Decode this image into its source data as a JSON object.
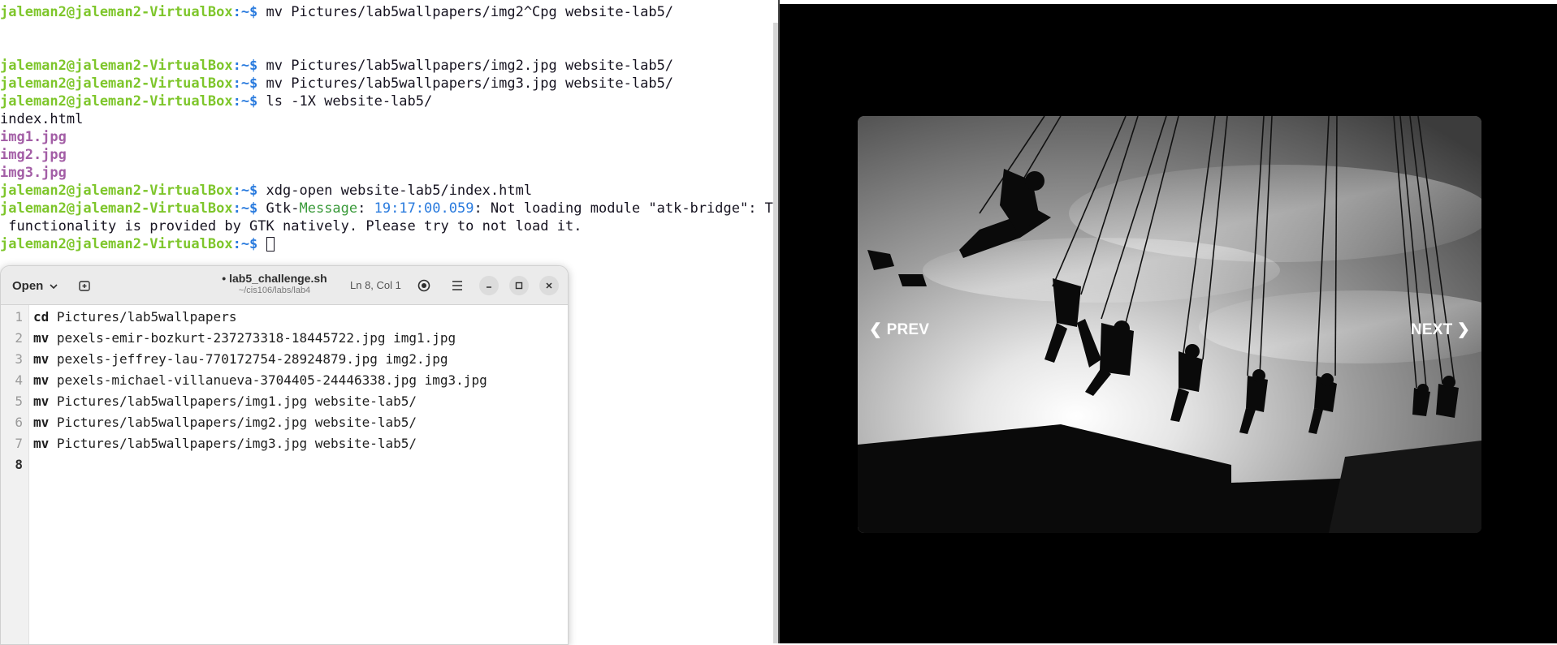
{
  "terminal": {
    "user_host": "jaleman2@jaleman2-VirtualBox",
    "path": ":~$",
    "commands": {
      "c1": " mv Pictures/lab5wallpapers/img2^Cpg website-lab5/",
      "c2": " mv Pictures/lab5wallpapers/img2.jpg website-lab5/",
      "c3": " mv Pictures/lab5wallpapers/img3.jpg website-lab5/",
      "c4": " ls -1X website-lab5/",
      "c5": " xdg-open website-lab5/index.html",
      "c6_pre": " Gtk-",
      "c6_word": "Message",
      "c6_colon": ": ",
      "c6_time": "19:17:00.059",
      "c6_rest": ": Not loading module \"atk-bridge\": The",
      "c6_wrap": " functionality is provided by GTK natively. Please try to not load it.",
      "c7": " "
    },
    "ls_output": [
      "index.html",
      "img1.jpg",
      "img2.jpg",
      "img3.jpg"
    ]
  },
  "browser": {
    "prev_label": "❮ PREV",
    "next_label": "NEXT ❯",
    "colors": {
      "background": "#000000",
      "nav_text": "#ffffff"
    }
  },
  "editor": {
    "open_label": "Open",
    "file_title": "• lab5_challenge.sh",
    "file_path": "~/cis106/labs/lab4",
    "cursor_pos": "Ln 8, Col  1",
    "line_numbers": [
      "1",
      "2",
      "3",
      "4",
      "5",
      "6",
      "7",
      "8"
    ],
    "lines": [
      {
        "cmd": "cd",
        "args": " Pictures/lab5wallpapers"
      },
      {
        "cmd": "mv",
        "args": " pexels-emir-bozkurt-237273318-18445722.jpg img1.jpg"
      },
      {
        "cmd": "mv",
        "args": " pexels-jeffrey-lau-770172754-28924879.jpg img2.jpg"
      },
      {
        "cmd": "mv",
        "args": " pexels-michael-villanueva-3704405-24446338.jpg img3.jpg"
      },
      {
        "cmd": "mv",
        "args": " Pictures/lab5wallpapers/img1.jpg website-lab5/"
      },
      {
        "cmd": "mv",
        "args": " Pictures/lab5wallpapers/img2.jpg website-lab5/"
      },
      {
        "cmd": "mv",
        "args": " Pictures/lab5wallpapers/img3.jpg website-lab5/"
      },
      {
        "cmd": "",
        "args": ""
      }
    ]
  },
  "colors": {
    "prompt_user": "#7ec62b",
    "prompt_path": "#2a7bde",
    "ls_file": "#a35ea6"
  },
  "icons": [
    "chevron-down-icon",
    "new-tab-icon",
    "settings-icon",
    "hamburger-menu-icon",
    "minimize-icon",
    "maximize-icon",
    "close-icon"
  ]
}
